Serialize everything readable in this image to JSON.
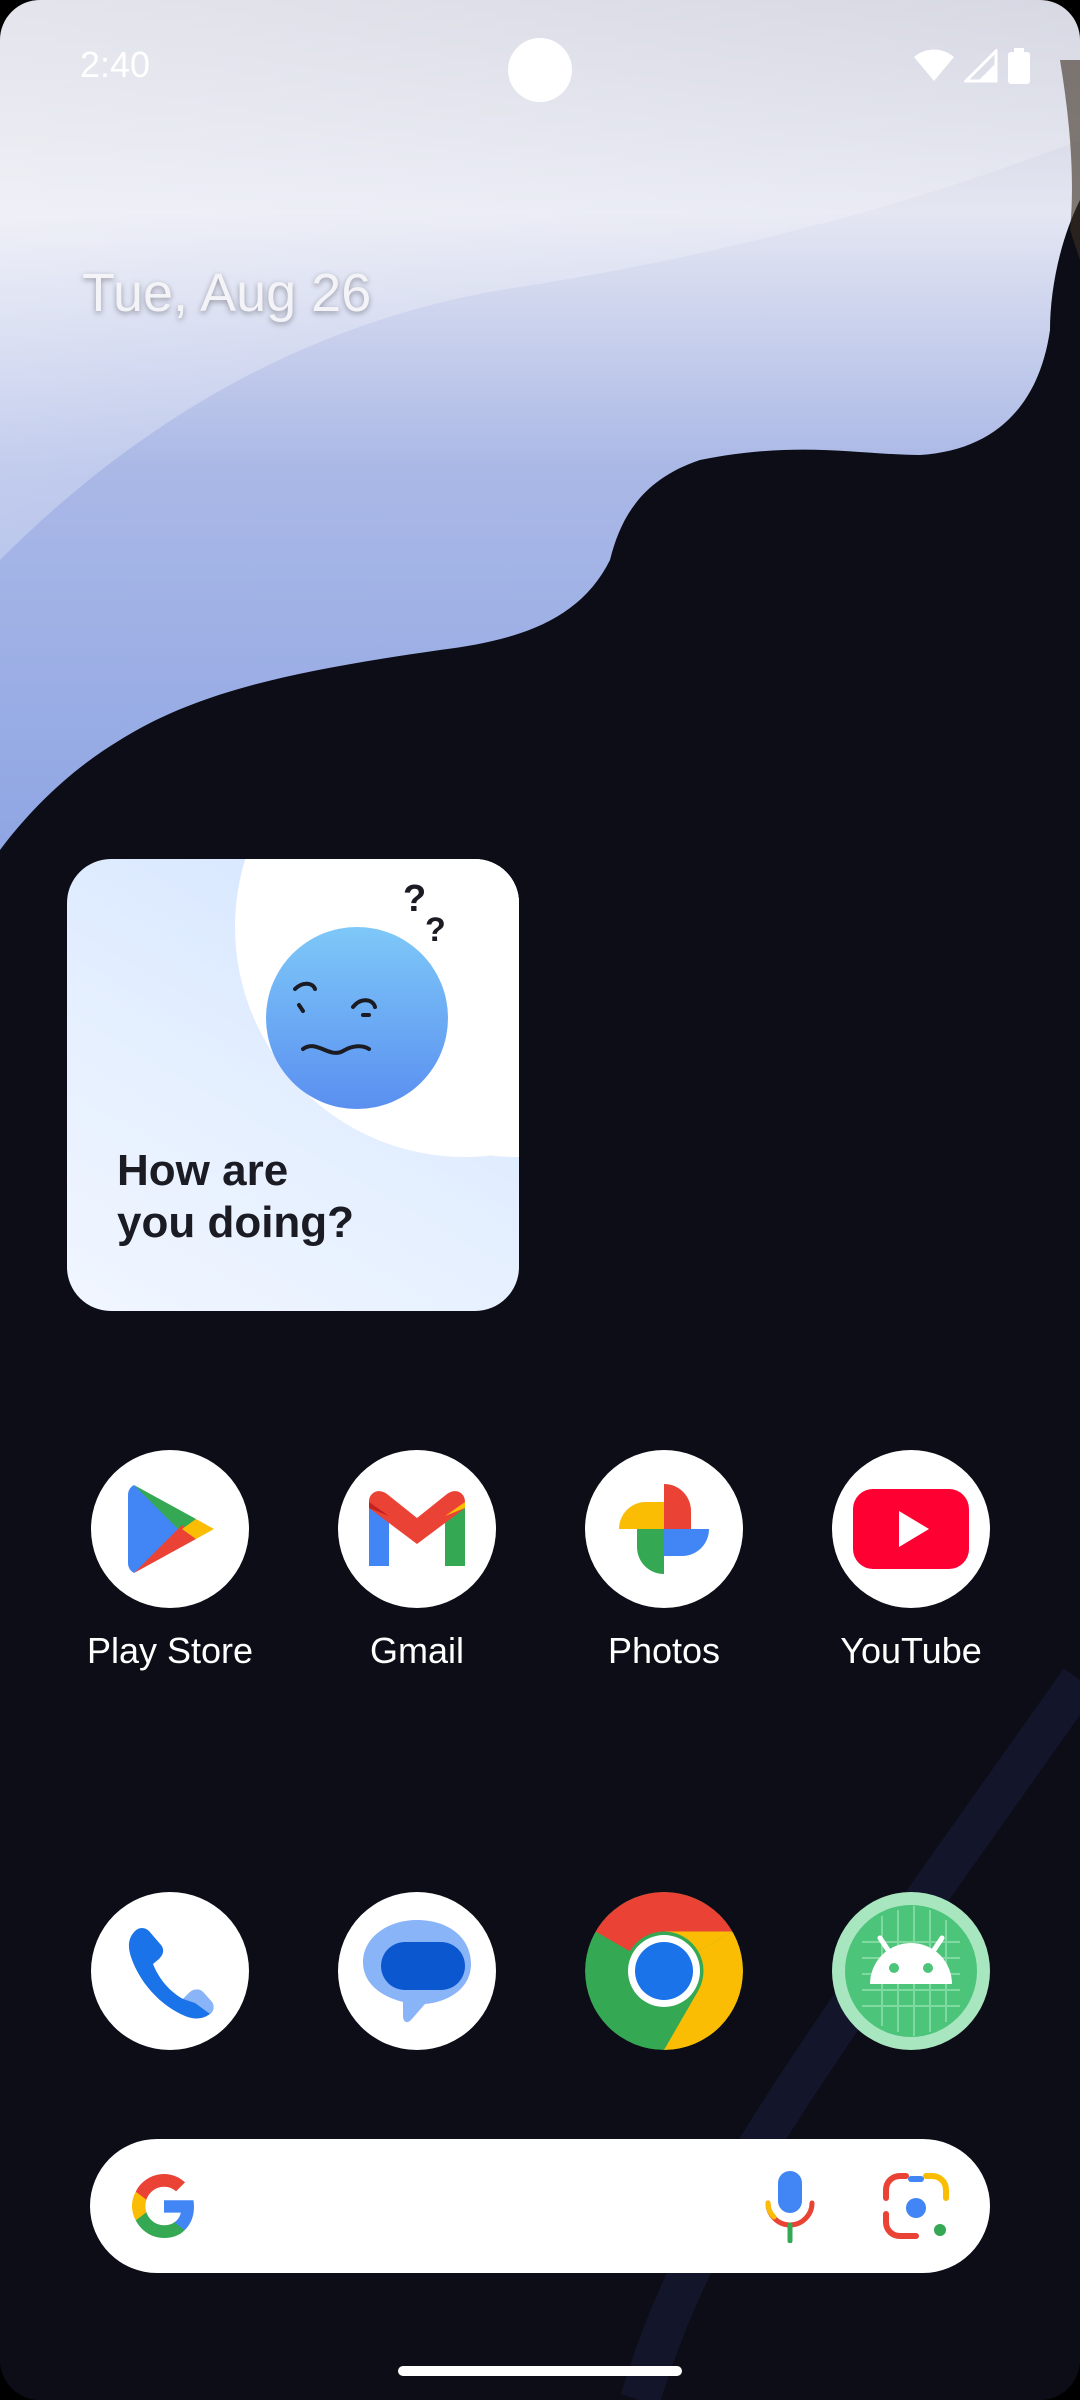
{
  "status_bar": {
    "time": "2:40",
    "icons": [
      "wifi-icon",
      "signal-icon",
      "battery-icon"
    ]
  },
  "date": "Tue, Aug 26",
  "widget": {
    "text": "How are\nyou doing?",
    "icon": "confused-face-icon"
  },
  "apps_row1": [
    {
      "label": "Play Store",
      "icon": "play-store-icon"
    },
    {
      "label": "Gmail",
      "icon": "gmail-icon"
    },
    {
      "label": "Photos",
      "icon": "photos-icon"
    },
    {
      "label": "YouTube",
      "icon": "youtube-icon"
    }
  ],
  "dock": [
    {
      "icon": "phone-icon"
    },
    {
      "icon": "messages-icon"
    },
    {
      "icon": "chrome-icon"
    },
    {
      "icon": "android-icon"
    }
  ],
  "search_bar": {
    "icons": [
      "google-logo-icon",
      "microphone-icon",
      "google-lens-icon"
    ]
  },
  "colors": {
    "background": "#0d0d17",
    "widget_bg": "#d2e4ff",
    "face": "#64a4f4",
    "youtube_red": "#ff0033",
    "google_blue": "#4285f4",
    "google_red": "#ea4335",
    "google_yellow": "#fbbc04",
    "google_green": "#34a853"
  }
}
